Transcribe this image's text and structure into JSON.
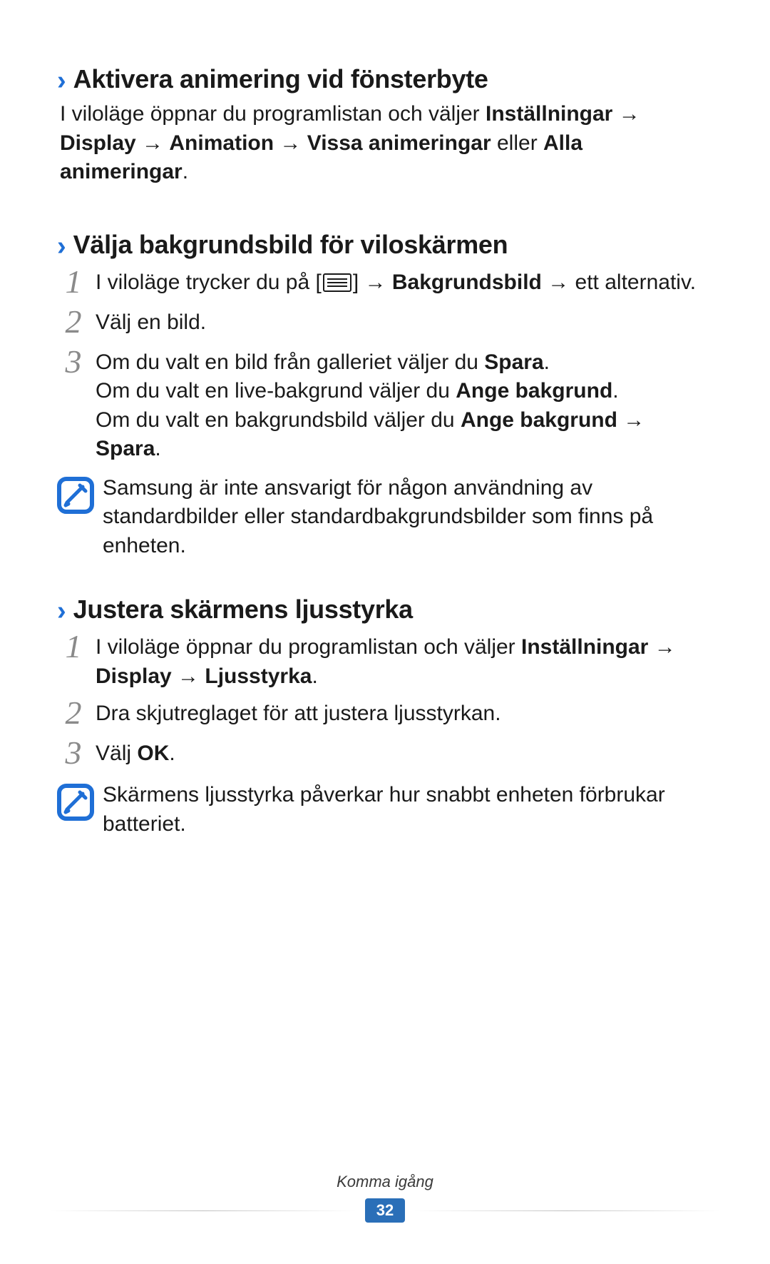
{
  "sections": {
    "s1": {
      "chevron": "›",
      "title": "Aktivera animering vid fönsterbyte",
      "body_parts": {
        "p1": "I viloläge öppnar du programlistan och väljer ",
        "b1": "Inställningar",
        "p2": " → ",
        "b2": "Display",
        "p3": " → ",
        "b3": "Animation",
        "p4": " → ",
        "b4": "Vissa animeringar",
        "p5": " eller ",
        "b5": "Alla animeringar",
        "p6": "."
      }
    },
    "s2": {
      "chevron": "›",
      "title": "Välja bakgrundsbild för viloskärmen",
      "steps": {
        "n1": "1",
        "t1": {
          "a": "I viloläge trycker du på [",
          "b": "] → ",
          "c": "Bakgrundsbild",
          "d": " → ett alternativ."
        },
        "n2": "2",
        "t2": "Välj en bild.",
        "n3": "3",
        "t3": {
          "a": "Om du valt en bild från galleriet väljer du ",
          "b": "Spara",
          "c": ".",
          "d": "Om du valt en live-bakgrund väljer du ",
          "e": "Ange bakgrund",
          "f": ".",
          "g": "Om du valt en bakgrundsbild väljer du ",
          "h": "Ange bakgrund",
          "i": " → ",
          "j": "Spara",
          "k": "."
        }
      },
      "note": "Samsung är inte ansvarigt för någon användning av standardbilder eller standardbakgrundsbilder som finns på enheten."
    },
    "s3": {
      "chevron": "›",
      "title": "Justera skärmens ljusstyrka",
      "steps": {
        "n1": "1",
        "t1": {
          "a": "I viloläge öppnar du programlistan och väljer ",
          "b": "Inställningar",
          "c": " → ",
          "d": "Display",
          "e": " → ",
          "f": "Ljusstyrka",
          "g": "."
        },
        "n2": "2",
        "t2": "Dra skjutreglaget för att justera ljusstyrkan.",
        "n3": "3",
        "t3": {
          "a": "Välj ",
          "b": "OK",
          "c": "."
        }
      },
      "note": "Skärmens ljusstyrka påverkar hur snabbt enheten förbrukar batteriet."
    }
  },
  "footer": {
    "label": "Komma igång",
    "page": "32"
  }
}
